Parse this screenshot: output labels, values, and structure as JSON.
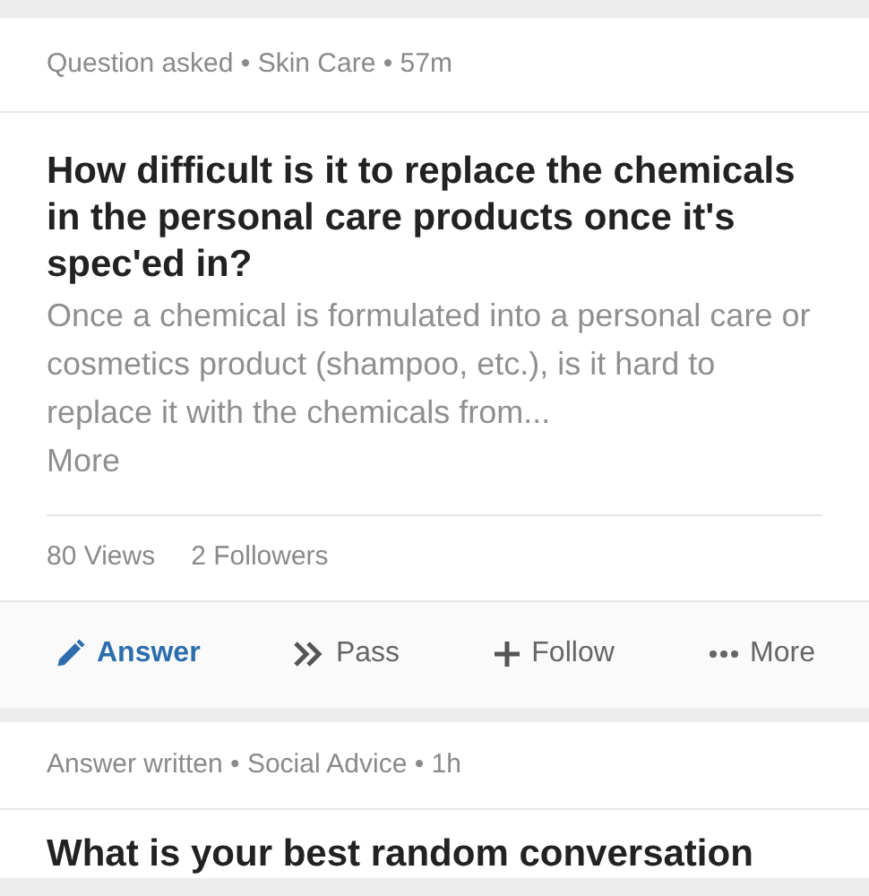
{
  "cards": [
    {
      "meta": "Question asked • Skin Care • 57m",
      "title": "How difficult is it to replace the chemicals in the personal care products once it's spec'ed in?",
      "excerpt": "Once a chemical is formulated into a personal care or cosmetics product (shampoo, etc.), is it hard to replace it with the chemicals from...",
      "more": "More",
      "stats": [
        "80 Views",
        "2 Followers"
      ],
      "actions": [
        {
          "kind": "answer",
          "label": "Answer"
        },
        {
          "kind": "pass",
          "label": "Pass"
        },
        {
          "kind": "follow",
          "label": "Follow"
        },
        {
          "kind": "more",
          "label": "More"
        }
      ]
    },
    {
      "meta": "Answer written • Social Advice • 1h",
      "title": "What is your best random conversation"
    }
  ]
}
